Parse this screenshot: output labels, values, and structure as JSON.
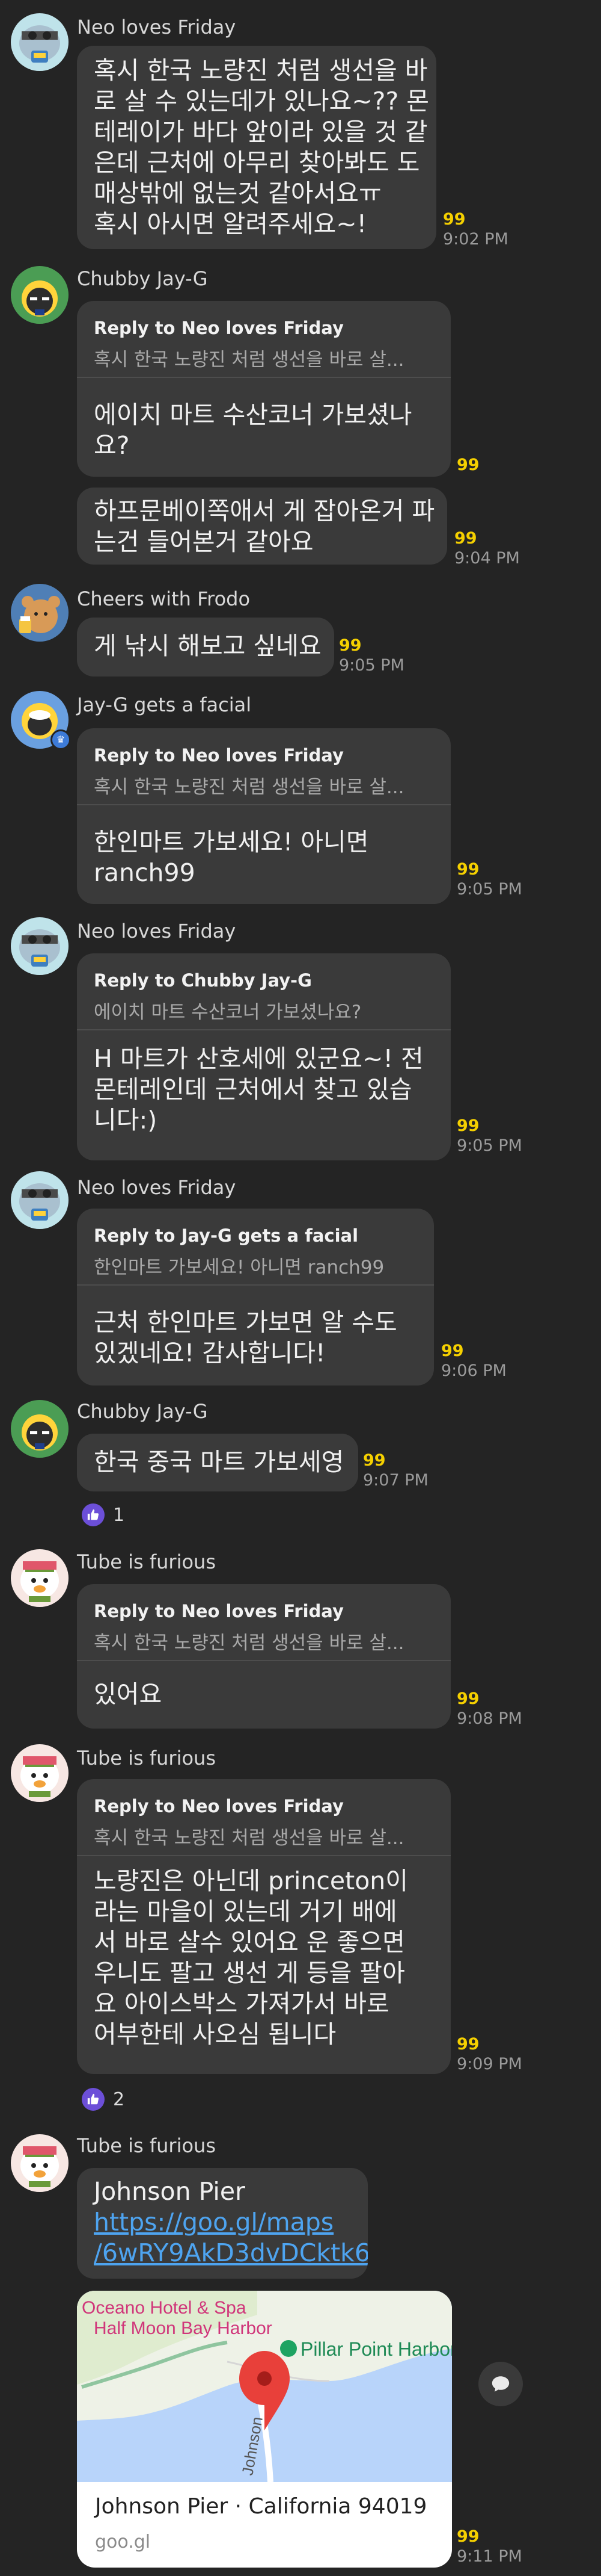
{
  "unread_marker": "99",
  "messages": [
    {
      "sender": "Neo loves Friday",
      "lines": [
        "혹시 한국 노량진 처럼 생선을 바",
        "로 살 수 있는데가 있나요~?? 몬",
        "테레이가 바다 앞이라 있을 것 같",
        "은데 근처에 아무리 찾아봐도 도",
        "매상밖에 없는것 같아서요ㅠ",
        "혹시 아시면 알려주세요~!"
      ],
      "time": "9:02 PM"
    },
    {
      "sender": "Chubby Jay-G",
      "reply_to": "Reply to Neo loves Friday",
      "reply_quote": "혹시 한국 노량진 처럼 생선을 바로 살...",
      "lines": [
        "에이치 마트 수산코너 가보셨나",
        "요?"
      ]
    },
    {
      "lines": [
        "하프문베이쪽애서 게 잡아온거 파",
        "는건 들어본거 같아요"
      ],
      "time": "9:04 PM"
    },
    {
      "sender": "Cheers with Frodo",
      "lines": [
        "게 낚시 해보고 싶네요"
      ],
      "time": "9:05 PM"
    },
    {
      "sender": "Jay-G gets a facial",
      "reply_to": "Reply to Neo loves Friday",
      "reply_quote": "혹시 한국 노량진 처럼 생선을 바로 살...",
      "lines": [
        "한인마트 가보세요! 아니면",
        "ranch99"
      ],
      "time": "9:05 PM"
    },
    {
      "sender": "Neo loves Friday",
      "reply_to": "Reply to Chubby Jay-G",
      "reply_quote": "에이치 마트 수산코너 가보셨나요?",
      "lines": [
        "H 마트가 산호세에 있군요~! 전",
        "몬테레인데 근처에서 찾고 있습",
        "니다:)"
      ],
      "time": "9:05 PM"
    },
    {
      "sender": "Neo loves Friday",
      "reply_to": "Reply to Jay-G gets a facial",
      "reply_quote": "한인마트 가보세요! 아니면  ranch99",
      "lines": [
        "근처 한인마트 가보면 알 수도",
        "있겠네요! 감사합니다!"
      ],
      "time": "9:06 PM"
    },
    {
      "sender": "Chubby Jay-G",
      "lines": [
        "한국 중국 마트 가보세영"
      ],
      "time": "9:07 PM",
      "reaction_count": "1"
    },
    {
      "sender": "Tube is furious",
      "reply_to": "Reply to Neo loves Friday",
      "reply_quote": "혹시 한국 노량진 처럼 생선을 바로 살...",
      "lines": [
        "있어요"
      ],
      "time": "9:08 PM"
    },
    {
      "sender": "Tube is furious",
      "reply_to": "Reply to Neo loves Friday",
      "reply_quote": "혹시 한국 노량진 처럼 생선을 바로 살...",
      "lines": [
        "노량진은 아닌데 princeton이",
        "라는 마을이 있는데 거기 배에",
        "서 바로 살수 있어요 운 좋으면",
        "우니도 팔고 생선 게 등을 팔아",
        "요 아이스박스 가져가서 바로",
        "어부한테 사오심 됩니다"
      ],
      "time": "9:09 PM",
      "reaction_count": "2"
    },
    {
      "sender": "Tube is furious",
      "title": "Johnson Pier",
      "url_lines": [
        "https://goo.gl/maps",
        "/6wRY9AkD3dvDCktk6"
      ],
      "time": "9:11 PM"
    }
  ],
  "link_card": {
    "map_labels": [
      "Oceano Hotel & Spa",
      "Half Moon Bay Harbor",
      "Pillar Point Harbor",
      "Johnson"
    ],
    "title": "Johnson Pier · California 94019",
    "domain": "goo.gl"
  },
  "icons": {
    "reaction": "thumbs-up-icon",
    "share": "speech-bubble-icon",
    "badge": "crown-icon"
  }
}
